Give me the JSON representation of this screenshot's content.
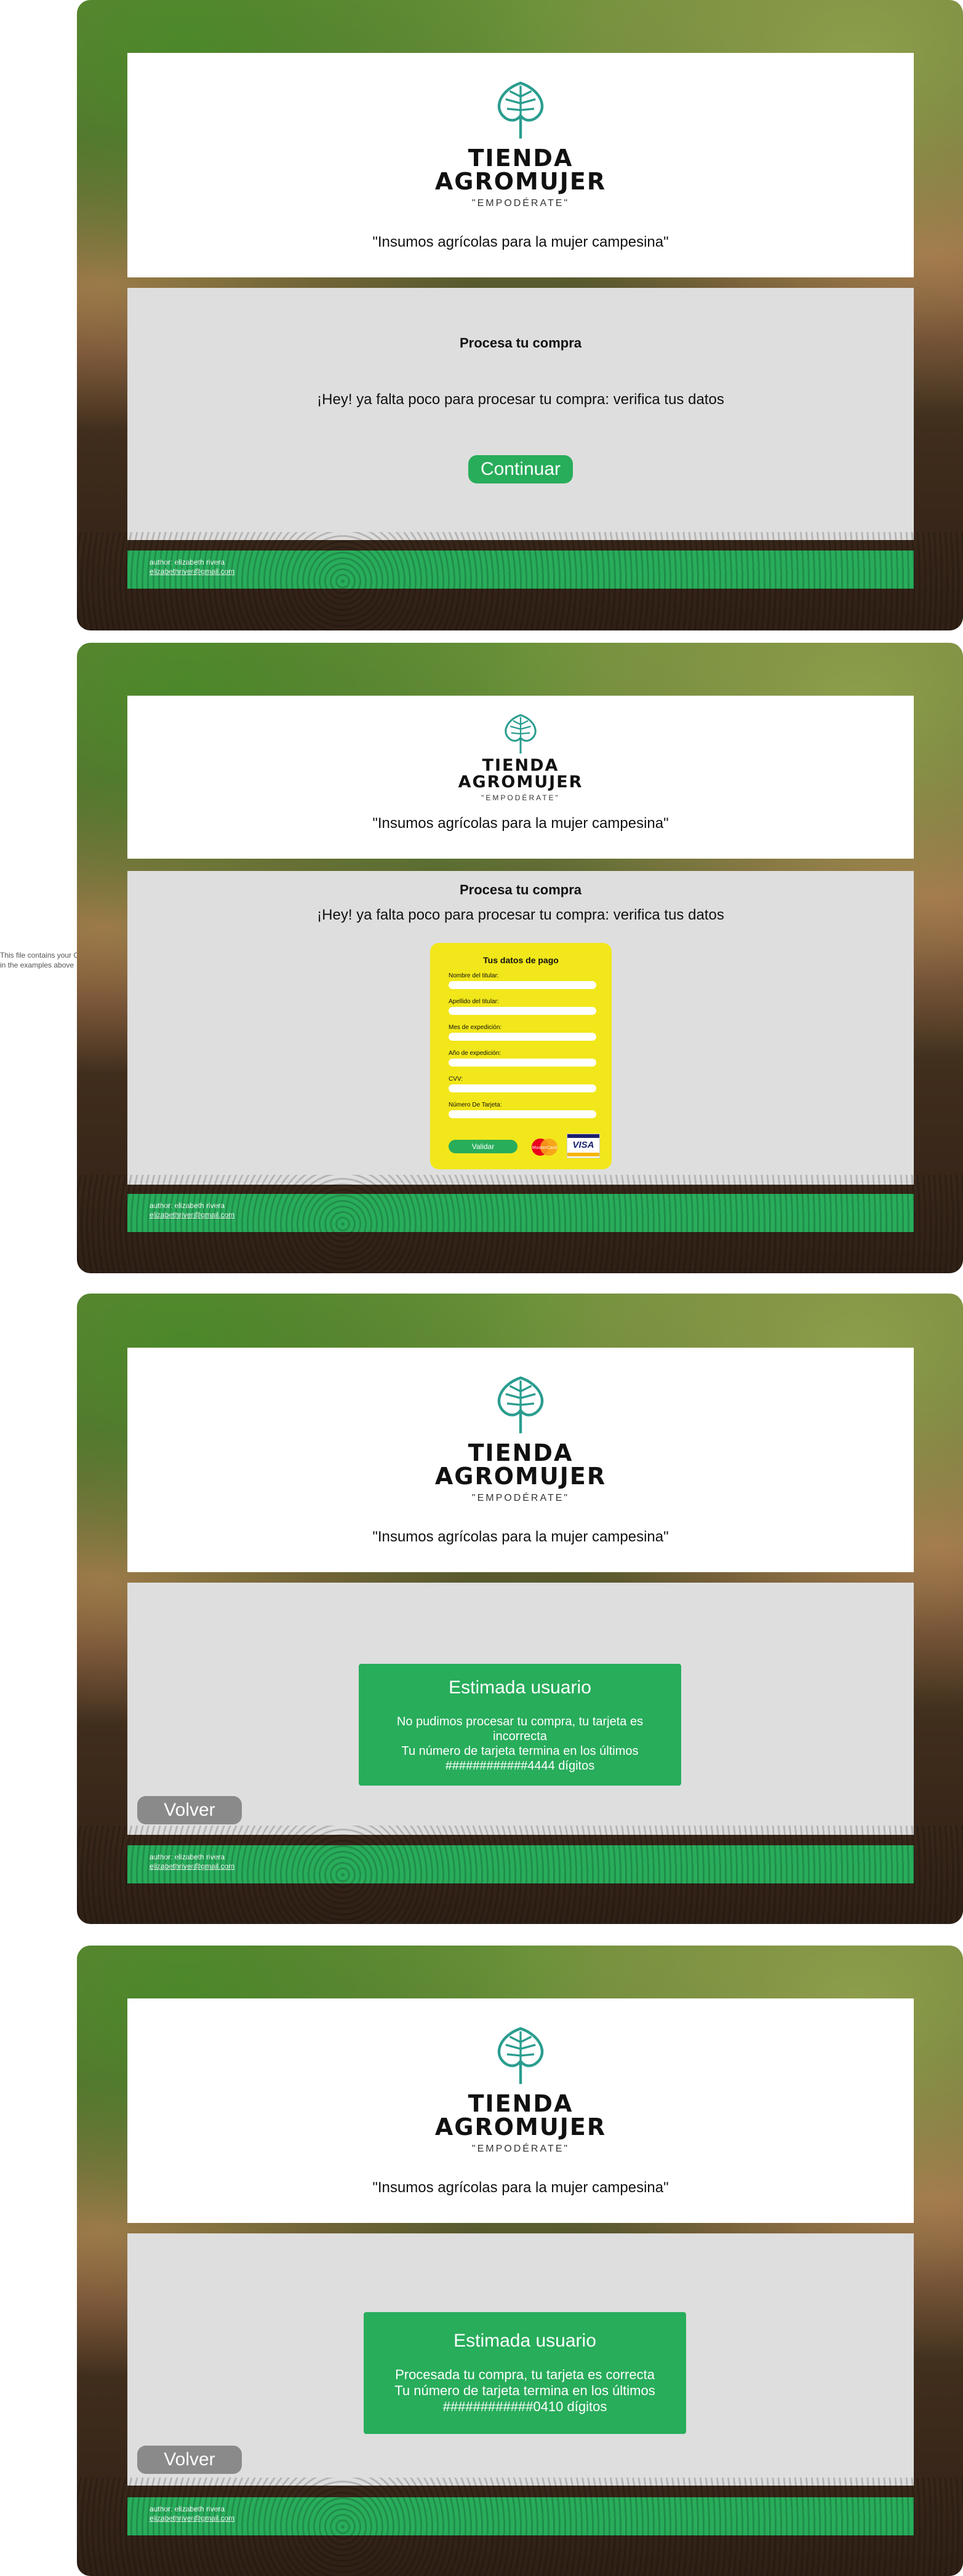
{
  "brand": {
    "name_line1": "TIENDA",
    "name_line2": "AGROMUJER",
    "slogan": "\"EMPODÉRATE\"",
    "tagline": "\"Insumos agrícolas para la mujer campesina\""
  },
  "side_note": {
    "line1": "This file contains your C",
    "line2": "in the examples above"
  },
  "footer": {
    "author": "author: elizabeth rivera",
    "email": "elizabethriver@gmail.com"
  },
  "screen1": {
    "title": "Procesa tu compra",
    "subtitle": "¡Hey! ya falta poco para procesar tu compra: verifica tus datos",
    "continue_label": "Continuar"
  },
  "screen2": {
    "title": "Procesa tu compra",
    "subtitle": "¡Hey! ya falta poco para procesar tu compra: verifica tus datos",
    "form": {
      "title": "Tus datos de pago",
      "fields": [
        {
          "label": "Nombre del titular:"
        },
        {
          "label": "Apellido del titular:"
        },
        {
          "label": "Mes de expedición:"
        },
        {
          "label": "Año de expedición:"
        },
        {
          "label": "CVV:"
        },
        {
          "label": "Número De Tarjeta:"
        }
      ],
      "submit_label": "Validar",
      "card_mastercard": "MasterCard",
      "card_visa": "VISA"
    }
  },
  "screen3": {
    "modal_title": "Estimada usuario",
    "modal_line1": "No pudimos procesar tu compra, tu tarjeta es",
    "modal_line2": "incorrecta",
    "modal_line3": "Tu número de tarjeta termina en los últimos",
    "modal_line4": "############4444 dígitos",
    "back_label": "Volver"
  },
  "screen4": {
    "modal_title": "Estimada usuario",
    "modal_line1": "Procesada tu compra, tu tarjeta es correcta",
    "modal_line2": "Tu número de tarjeta termina en los últimos",
    "modal_line3": "############0410 dígitos",
    "back_label": "Volver"
  },
  "colors": {
    "accent_green": "#28ad5b",
    "logo_teal": "#2a9d8f",
    "form_yellow": "#f2e71a",
    "card_gray": "#dedede",
    "back_button_gray": "#8a8a8a"
  }
}
